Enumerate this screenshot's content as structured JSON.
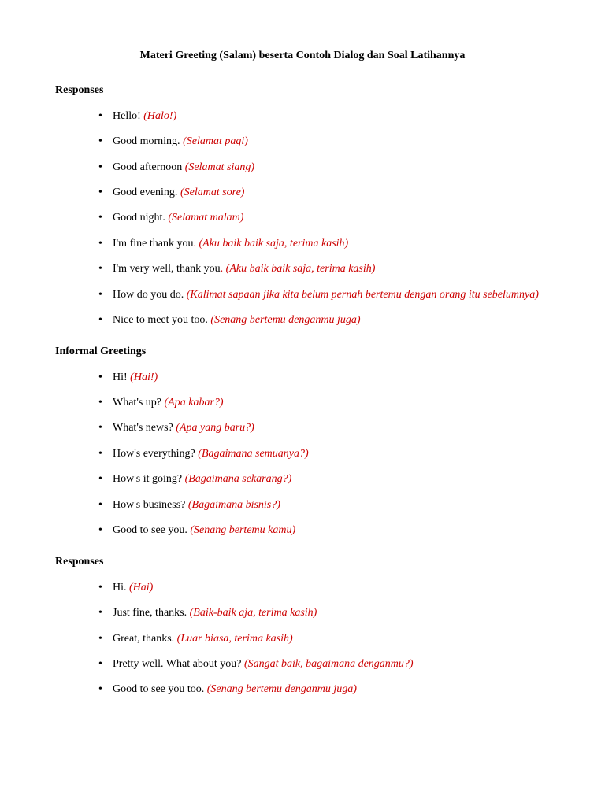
{
  "title": "Materi Greeting (Salam) beserta Contoh Dialog dan Soal Latihannya",
  "sections": [
    {
      "heading": "Responses",
      "items": [
        {
          "en": "Hello! ",
          "trans": "(Halo!)",
          "dot": false
        },
        {
          "en": "Good morning. ",
          "trans": "(Selamat pagi)",
          "dot": false
        },
        {
          "en": "Good afternoon ",
          "trans": "(Selamat siang)",
          "dot": false
        },
        {
          "en": "Good evening. ",
          "trans": "(Selamat sore)",
          "dot": false
        },
        {
          "en": "Good night. ",
          "trans": "(Selamat malam)",
          "dot": false
        },
        {
          "en": "I'm fine thank you",
          "trans": "(Aku baik baik saja, terima kasih)",
          "dot": true
        },
        {
          "en": "I'm very well, thank you",
          "trans": "(Aku baik baik saja, terima kasih)",
          "dot": true
        },
        {
          "en": "How do you do. ",
          "trans": "(Kalimat sapaan jika kita belum pernah bertemu dengan orang itu sebelumnya)",
          "dot": false
        },
        {
          "en": "Nice to meet you too. ",
          "trans": "(Senang bertemu denganmu juga)",
          "dot": false
        }
      ]
    },
    {
      "heading": "Informal Greetings",
      "items": [
        {
          "en": "Hi! ",
          "trans": "(Hai!)",
          "dot": false
        },
        {
          "en": "What's up? ",
          "trans": "(Apa kabar?)",
          "dot": false
        },
        {
          "en": "What's news? ",
          "trans": "(Apa yang baru?)",
          "dot": false
        },
        {
          "en": "How's everything? ",
          "trans": "(Bagaimana semuanya?)",
          "dot": false
        },
        {
          "en": "How's it going? ",
          "trans": "(Bagaimana sekarang?)",
          "dot": false
        },
        {
          "en": "How's business? ",
          "trans": "(Bagaimana bisnis?)",
          "dot": false
        },
        {
          "en": "Good to see you. ",
          "trans": "(Senang bertemu kamu)",
          "dot": false
        }
      ]
    },
    {
      "heading": "Responses",
      "items": [
        {
          "en": "Hi. ",
          "trans": "(Hai)",
          "dot": false
        },
        {
          "en": "Just fine, thanks. ",
          "trans": "(Baik-baik aja, terima kasih)",
          "dot": false
        },
        {
          "en": "Great, thanks. ",
          "trans": "(Luar biasa, terima kasih)",
          "dot": false
        },
        {
          "en": "Pretty well. What about you? ",
          "trans": "(Sangat baik, bagaimana denganmu?)",
          "dot": false
        },
        {
          "en": "Good to see you too. ",
          "trans": "(Senang bertemu denganmu juga)",
          "dot": false
        }
      ]
    }
  ]
}
